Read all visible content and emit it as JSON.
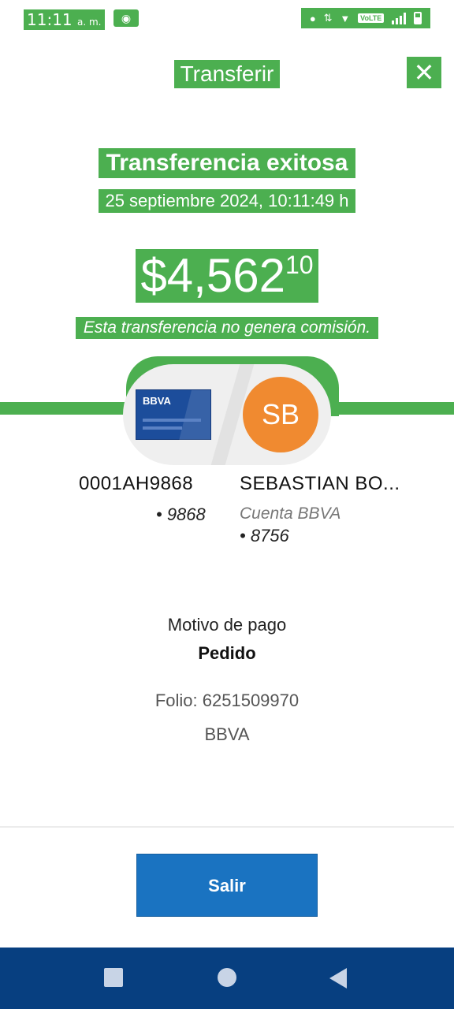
{
  "status_bar": {
    "time": "11:11",
    "ampm": "a. m.",
    "volte": "VoLTE"
  },
  "header": {
    "title": "Transferir",
    "close_icon": "close-icon"
  },
  "success": {
    "title": "Transferencia exitosa",
    "datetime": "25 septiembre 2024, 10:11:49 h",
    "amount_main": "$4,562",
    "amount_cents": "10",
    "commission_note": "Esta transferencia no genera comisión."
  },
  "origin": {
    "card_logo": "BBVA",
    "account_name": "0001AH9868",
    "last_digits": "• 9868"
  },
  "destination": {
    "initials": "SB",
    "name": "SEBASTIAN BO...",
    "account_type": "Cuenta BBVA",
    "last_digits": "• 8756"
  },
  "details": {
    "motivo_label": "Motivo de pago",
    "motivo_value": "Pedido",
    "folio": "Folio: 6251509970",
    "bank": "BBVA"
  },
  "footer": {
    "salir_label": "Salir"
  },
  "colors": {
    "accent_green": "#4caf50",
    "button_blue": "#1a73c1",
    "nav_blue": "#073f80",
    "avatar_orange": "#f08a30",
    "card_blue": "#1c4d9b"
  },
  "nav_icons": [
    "square-recents-icon",
    "circle-home-icon",
    "triangle-back-icon"
  ]
}
